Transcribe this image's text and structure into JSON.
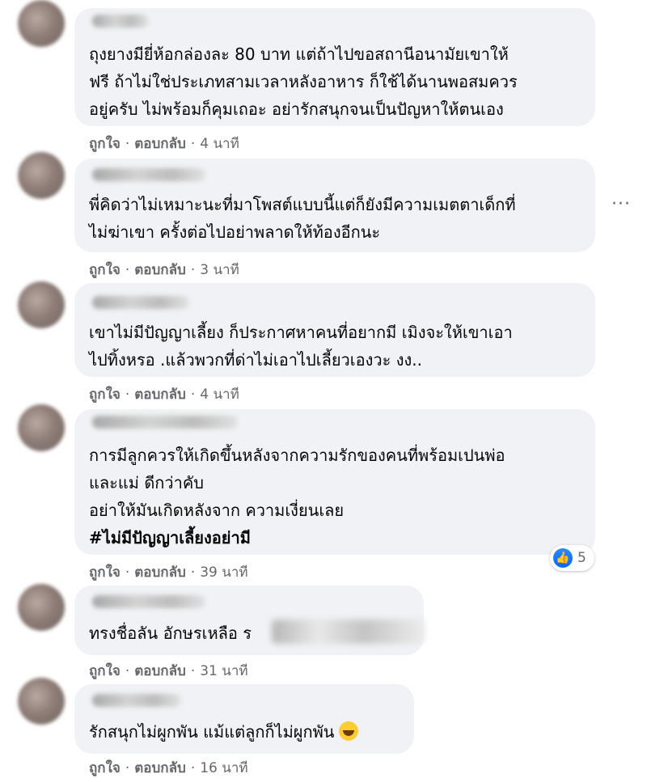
{
  "actions": {
    "like": "ถูกใจ",
    "reply": "ตอบกลับ",
    "dot": "·"
  },
  "comments": [
    {
      "lines": [
        "ถุงยางมียี่ห้อกล่องละ 80 บาท แต่ถ้าไปขอสถานีอนามัยเขาให้",
        "ฟรี ถ้าไม่ใช่ประเภทสามเวลาหลังอาหาร ก็ใช้ได้นานพอสมควร",
        "อยู่ครับ ไม่พร้อมก็คุมเถอะ อย่ารักสนุกจนเป็นปัญหาให้ตนเอง"
      ],
      "time": "4 นาที"
    },
    {
      "lines": [
        "พี่คิดว่าไม่เหมาะนะที่มาโพสต์แบบนี้แต่ก็ยังมีความเมตตาเด็กที่",
        "ไม่ฆ่าเขา ครั้งต่อไปอย่าพลาดให้ท้องอีกนะ"
      ],
      "time": "3 นาที",
      "more": "···"
    },
    {
      "lines": [
        "เขาไม่มีปัญญาเลี้ยง ก็ประกาศหาคนที่อยากมี เมิงจะให้เขาเอา",
        "ไปทิ้งหรอ .แล้วพวกที่ด่าไม่เอาไปเลี้ยวเองวะ งง.."
      ],
      "time": "4 นาที"
    },
    {
      "lines": [
        "การมีลูกควรให้เกิดขึ้นหลังจากความรักของคนที่พร้อมเปนพ่อ",
        "และแม่ ดีกว่าคับ",
        "อย่าให้มันเกิดหลังจาก ความเงี่ยนเลย"
      ],
      "hashtag": "#ไม่มีปัญญาเลี้ยงอย่ามี",
      "time": "39 นาที",
      "reaction_count": "5"
    },
    {
      "lines": [
        "ทรงชื่อลัน อักษรเหลือ ร"
      ],
      "time": "31 นาที"
    },
    {
      "lines": [
        "รักสนุกไม่ผูกพัน แม้แต่ลูกก็ไม่ผูกพัน"
      ],
      "time": "16 นาที"
    }
  ]
}
